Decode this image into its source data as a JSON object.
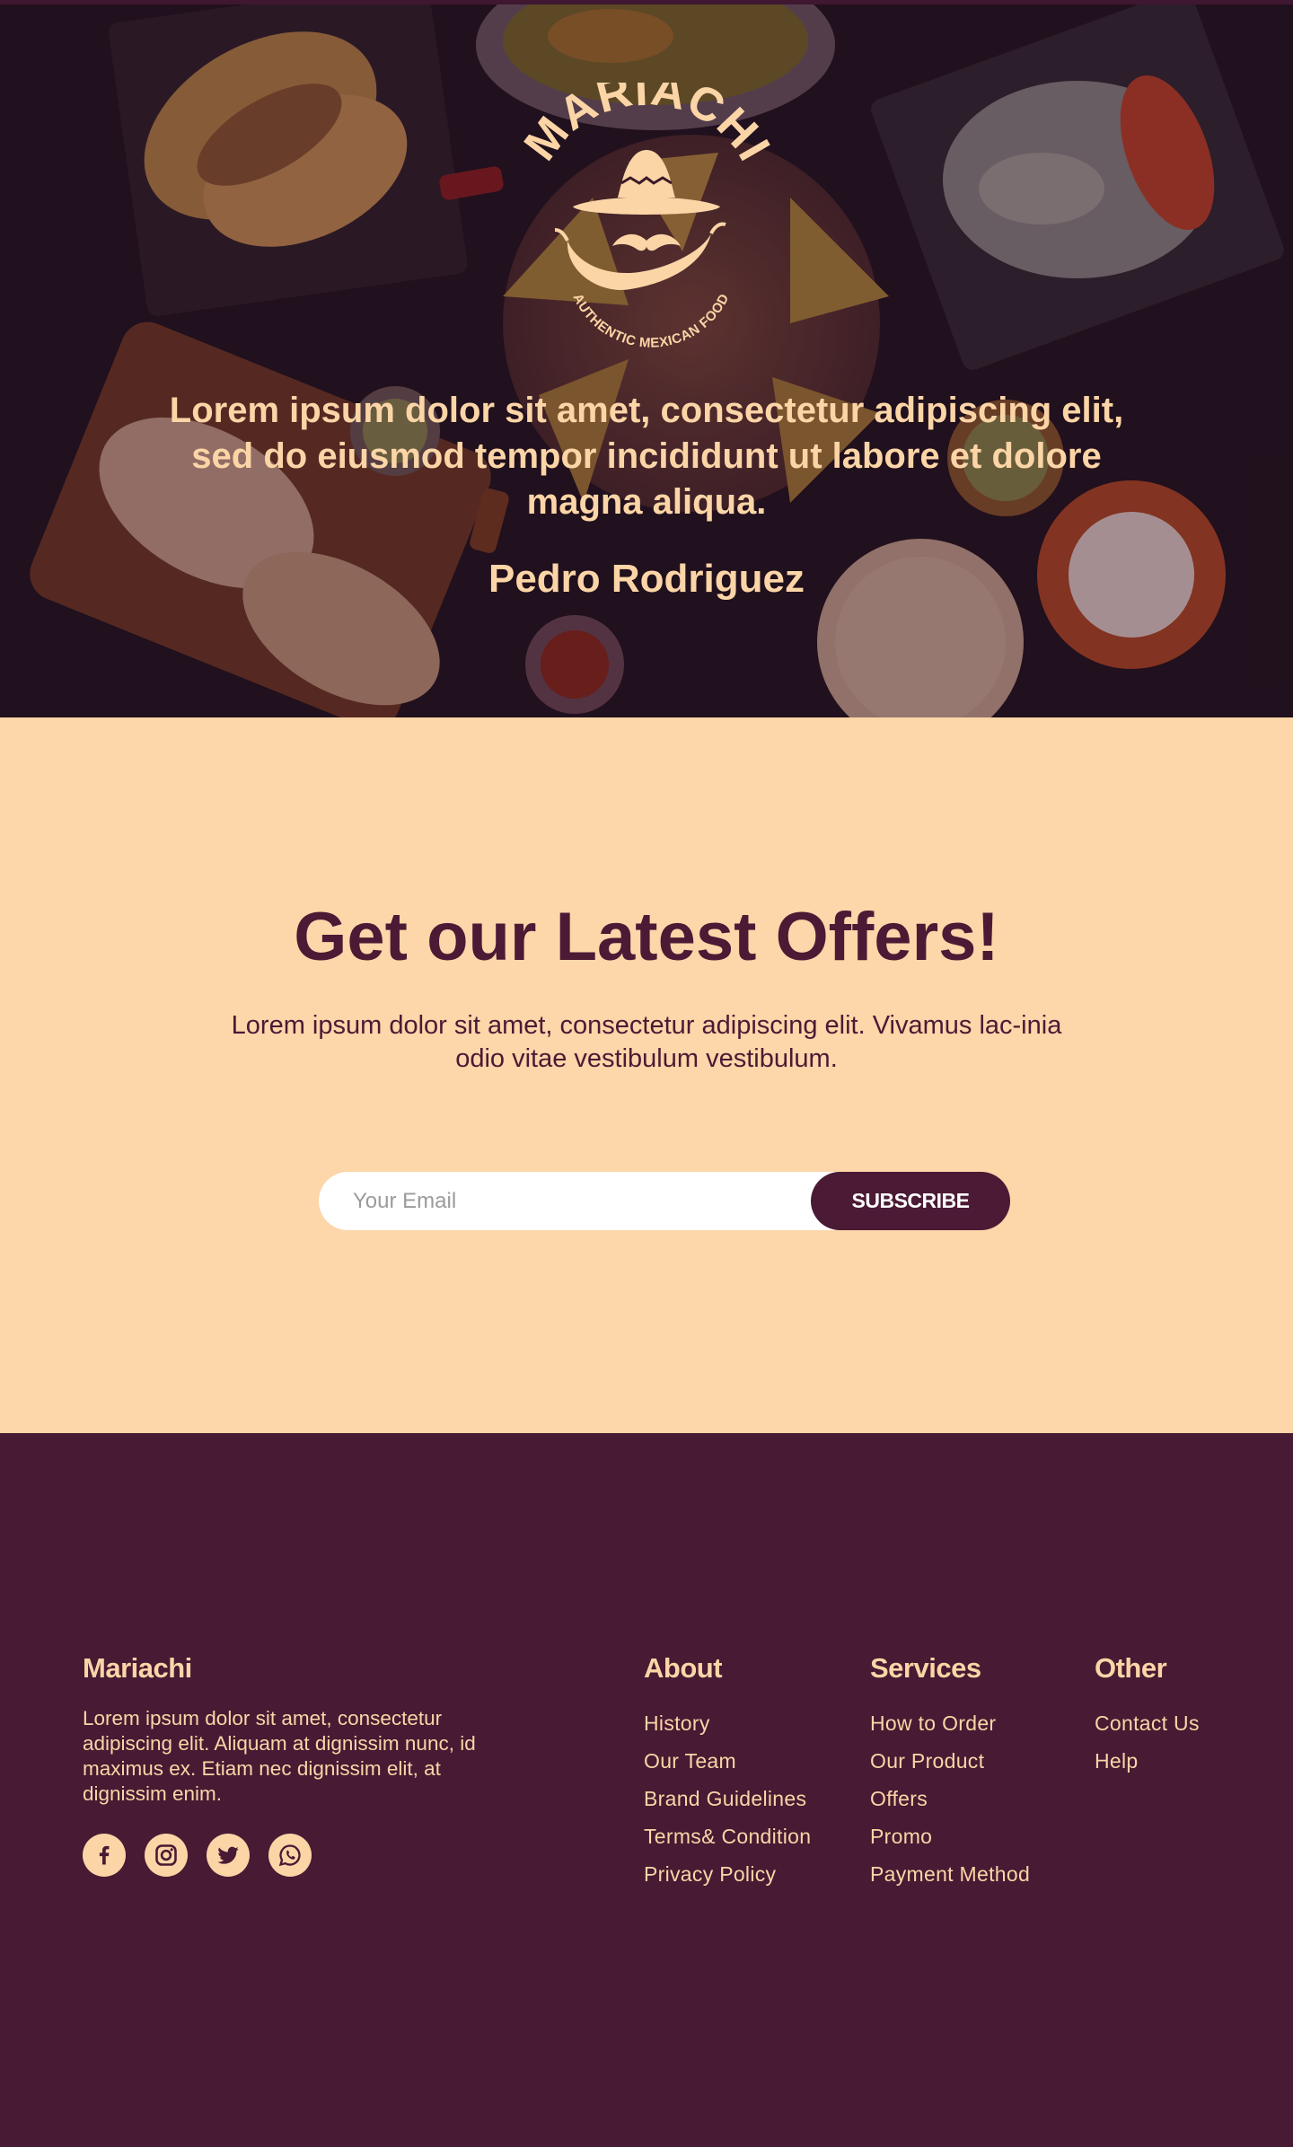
{
  "brand": {
    "logo_word": "MARIACHI",
    "logo_tagline": "AUTHENTIC MEXICAN FOOD"
  },
  "hero": {
    "quote": "Lorem ipsum dolor sit amet, consectetur adipiscing elit, sed do eiusmod tempor incididunt ut labore et dolore magna aliqua.",
    "author": "Pedro Rodriguez"
  },
  "newsletter": {
    "title": "Get our Latest Offers!",
    "text": "Lorem ipsum dolor sit amet, consectetur adipiscing elit. Vivamus lac-inia odio vitae vestibulum vestibulum.",
    "email_placeholder": "Your Email",
    "button_label": "SUBSCRIBE"
  },
  "footer": {
    "brand_name": "Mariachi",
    "brand_text": "Lorem ipsum dolor sit amet, consectetur adipiscing elit. Aliquam at dignissim nunc, id maximus ex. Etiam nec dignissim elit, at dignissim enim.",
    "socials": [
      "facebook-icon",
      "instagram-icon",
      "twitter-icon",
      "whatsapp-icon"
    ],
    "columns": [
      {
        "title": "About",
        "links": [
          "History",
          "Our Team",
          "Brand Guidelines",
          "Terms& Condition",
          "Privacy Policy"
        ]
      },
      {
        "title": "Services",
        "links": [
          "How to Order",
          "Our Product",
          "Offers",
          "Promo",
          "Payment Method"
        ]
      },
      {
        "title": "Other",
        "links": [
          "Contact Us",
          "Help"
        ]
      }
    ]
  },
  "colors": {
    "plum": "#481a33",
    "peach": "#fdd6a9",
    "cream_text": "#fcd5a7",
    "white": "#ffffff"
  }
}
